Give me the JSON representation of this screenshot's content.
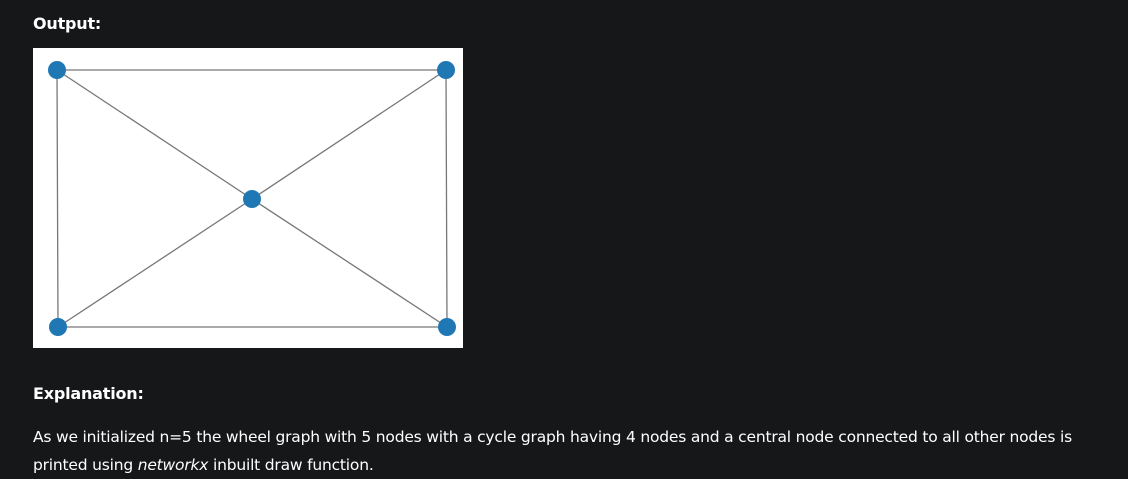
{
  "output_heading": "Output:",
  "explanation_heading": "Explanation:",
  "explanation": {
    "text_before": "As we initialized n=5 the wheel graph with 5 nodes with a cycle graph having 4 nodes and a central node connected to all other nodes is printed using ",
    "emphasis": "networkx",
    "text_after": " inbuilt draw function."
  },
  "graph": {
    "node_color": "#1f78b4",
    "edge_color": "#777777",
    "background": "#ffffff",
    "nodes": [
      "center",
      "top-left",
      "top-right",
      "bottom-right",
      "bottom-left"
    ],
    "edges": [
      [
        "center",
        "top-left"
      ],
      [
        "center",
        "top-right"
      ],
      [
        "center",
        "bottom-right"
      ],
      [
        "center",
        "bottom-left"
      ],
      [
        "top-left",
        "top-right"
      ],
      [
        "top-right",
        "bottom-right"
      ],
      [
        "bottom-right",
        "bottom-left"
      ],
      [
        "bottom-left",
        "top-left"
      ]
    ]
  }
}
